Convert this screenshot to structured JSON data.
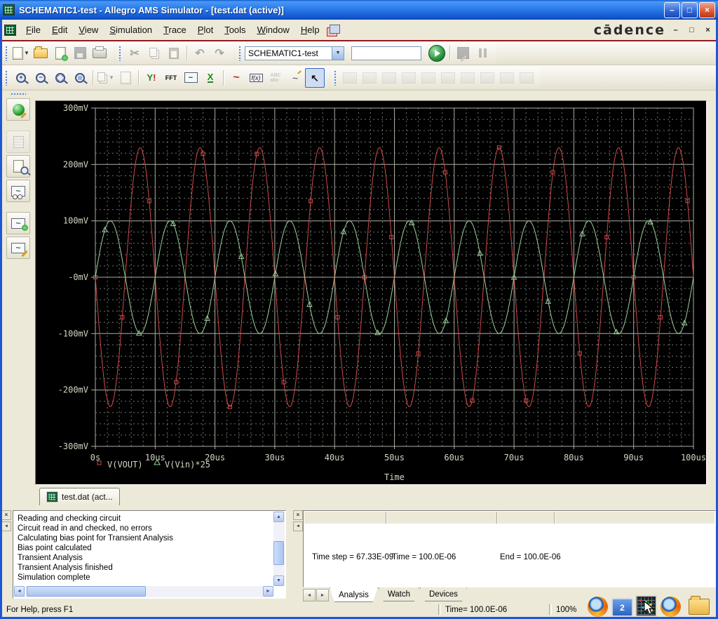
{
  "title_bar": {
    "title": "SCHEMATIC1-test - Allegro AMS Simulator - [test.dat (active)]"
  },
  "brand": "cādence",
  "menu": {
    "items": [
      "File",
      "Edit",
      "View",
      "Simulation",
      "Trace",
      "Plot",
      "Tools",
      "Window",
      "Help"
    ]
  },
  "toolbar1": {
    "profile": "SCHEMATIC1-test",
    "search": ""
  },
  "icons": {
    "cut": "✂",
    "undo": "↶",
    "redo": "↷",
    "zoom_in": "+",
    "zoom_out": "−",
    "y1": "Y",
    "y2": "!",
    "fft": "FFT",
    "wave": "~",
    "x_axis": "X",
    "fx": "f(x)",
    "abc_top": "ABC",
    "abc_bottom": "abc",
    "pointer": "↖",
    "combo_arrow": "▼",
    "win_min": "–",
    "win_max": "□",
    "win_close": "×",
    "mdi_min": "–",
    "mdi_restore": "□",
    "mdi_close": "×",
    "close_x": "×",
    "dock_arrow": "◄",
    "up": "▲",
    "down": "▼",
    "left": "◄",
    "right": "►"
  },
  "chart_data": {
    "type": "line",
    "title": "",
    "xlabel": "Time",
    "x_unit": "us",
    "x_range_us": [
      0,
      100
    ],
    "x_major_us": 10,
    "x_minor_us": 2,
    "y_unit": "mV",
    "y_range_mV": [
      -300,
      300
    ],
    "y_major_mV": 100,
    "y_minor_mV": 20,
    "x_tick_labels": [
      "0s",
      "10us",
      "20us",
      "30us",
      "40us",
      "50us",
      "60us",
      "70us",
      "80us",
      "90us",
      "100us"
    ],
    "y_tick_labels": [
      "300mV",
      "200mV",
      "100mV",
      "-0mV",
      "-100mV",
      "-200mV",
      "-300mV"
    ],
    "background": "#000000",
    "grid_major_color": "#a8b0a2",
    "grid_minor_color": "#6e766e",
    "text_color": "#d4d6c2",
    "legend_position": "bottom-left-inside",
    "grid": true,
    "series": [
      {
        "name": "V(VOUT)",
        "color": "#cf4a4a",
        "marker": "square",
        "waveform": "sine",
        "amplitude_mV": 230,
        "period_us": 10,
        "phase_deg": 180,
        "offset_mV": 0,
        "marker_every_us": 4.5,
        "marker_offset_us": 0
      },
      {
        "name": "V(Vin)*25",
        "color": "#9cd09c",
        "marker": "triangle",
        "waveform": "sine",
        "amplitude_mV": 100,
        "period_us": 10,
        "phase_deg": 0,
        "offset_mV": 0,
        "marker_every_us": 5.7,
        "marker_offset_us": 1.6
      }
    ]
  },
  "plot_tab": {
    "label": "test.dat (act..."
  },
  "messages": [
    "Reading and checking circuit",
    "Circuit read in and checked, no errors",
    "Calculating bias point for Transient Analysis",
    "Bias point calculated",
    "Transient Analysis",
    "Transient Analysis finished",
    "Simulation complete"
  ],
  "sim_panel": {
    "time_step": "Time step =  67.33E-09",
    "time": "Time =  100.0E-06",
    "end": "End =  100.0E-06",
    "tabs": [
      "Analysis",
      "Watch",
      "Devices"
    ]
  },
  "status_bar": {
    "help": "For Help, press F1",
    "time": "Time= 100.0E-06",
    "zoom": "100%"
  },
  "taskbar": {
    "monitor_label": "2"
  }
}
